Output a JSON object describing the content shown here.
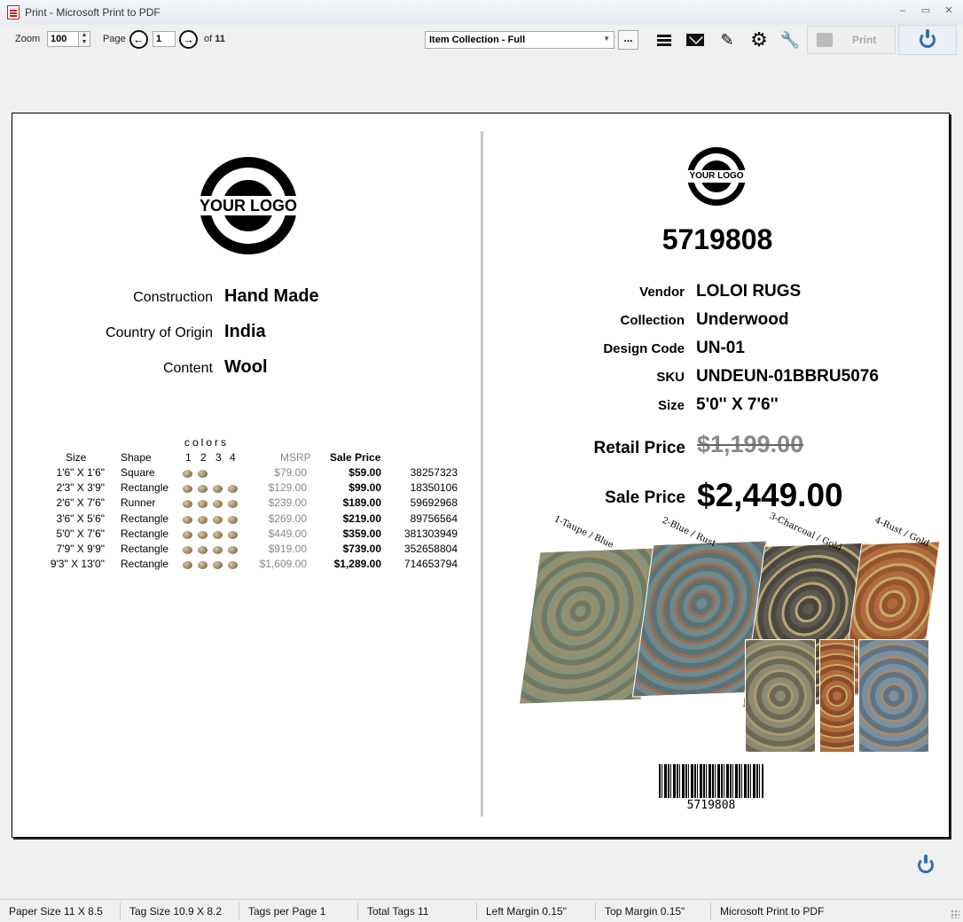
{
  "window": {
    "title": "Print - Microsoft Print to PDF",
    "controls": [
      "minimize",
      "maximize",
      "close"
    ]
  },
  "toolbar": {
    "zoom_label": "Zoom",
    "zoom_value": "100",
    "page_label": "Page",
    "page_value": "1",
    "of_label": "of",
    "page_total": "11",
    "template_select": "Item Collection - Full",
    "more_label": "...",
    "print_label": "Print",
    "icons": [
      "menu-icon",
      "mail-icon",
      "edit-icon",
      "gear-icon",
      "tools-icon",
      "printer-icon",
      "power-icon"
    ]
  },
  "left": {
    "logo_text": "YOUR LOGO",
    "attributes": [
      {
        "label": "Construction",
        "value": "Hand Made"
      },
      {
        "label": "Country of Origin",
        "value": "India"
      },
      {
        "label": "Content",
        "value": "Wool"
      }
    ],
    "table": {
      "colors_header": "colors",
      "color_numbers": [
        "1",
        "2",
        "3",
        "4"
      ],
      "headers": {
        "size": "Size",
        "shape": "Shape",
        "msrp": "MSRP",
        "sale": "Sale Price"
      },
      "rows": [
        {
          "size": "1'6\" X 1'6\"",
          "shape": "Square",
          "dots": 2,
          "msrp": "$79.00",
          "sale": "$59.00",
          "sku": "38257323"
        },
        {
          "size": "2'3\" X 3'9\"",
          "shape": "Rectangle",
          "dots": 4,
          "msrp": "$129.00",
          "sale": "$99.00",
          "sku": "18350106"
        },
        {
          "size": "2'6\" X 7'6\"",
          "shape": "Runner",
          "dots": 4,
          "msrp": "$239.00",
          "sale": "$189.00",
          "sku": "59692968"
        },
        {
          "size": "3'6\" X 5'6\"",
          "shape": "Rectangle",
          "dots": 4,
          "msrp": "$269.00",
          "sale": "$219.00",
          "sku": "89756564"
        },
        {
          "size": "5'0\" X 7'6\"",
          "shape": "Rectangle",
          "dots": 4,
          "msrp": "$449.00",
          "sale": "$359.00",
          "sku": "381303949"
        },
        {
          "size": "7'9\" X 9'9\"",
          "shape": "Rectangle",
          "dots": 4,
          "msrp": "$919.00",
          "sale": "$739.00",
          "sku": "352658804"
        },
        {
          "size": "9'3\" X 13'0\"",
          "shape": "Rectangle",
          "dots": 4,
          "msrp": "$1,609.00",
          "sale": "$1,289.00",
          "sku": "714653794"
        }
      ]
    }
  },
  "right": {
    "logo_text": "YOUR LOGO",
    "item_number": "5719808",
    "details": [
      {
        "label": "Vendor",
        "value": "LOLOI RUGS"
      },
      {
        "label": "Collection",
        "value": "Underwood"
      },
      {
        "label": "Design Code",
        "value": "UN-01"
      },
      {
        "label": "SKU",
        "value": "UNDEUN-01BBRU5076"
      },
      {
        "label": "Size",
        "value": "5'0'' X 7'6''"
      }
    ],
    "retail_label": "Retail Price",
    "retail_value": "$1,199.00",
    "sale_label": "Sale Price",
    "sale_value": "$2,449.00",
    "rug_colors": [
      {
        "label": "1-Taupe / Blue",
        "color": "#7f8a78"
      },
      {
        "label": "2-Blue / Rust",
        "color": "#6f8a8e"
      },
      {
        "label": "3-Charcoal / Gold",
        "color": "#5e5a50"
      },
      {
        "label": "4-Rust / Gold",
        "color": "#b06a3e"
      }
    ],
    "barcode_number": "5719808"
  },
  "statusbar": [
    "Paper Size 11 X 8.5",
    "Tag Size 10.9 X 8.2",
    "Tags per Page 1",
    "Total Tags 11",
    "Left Margin 0.15\"",
    "Top Margin 0.15\"",
    "Microsoft Print to PDF"
  ]
}
